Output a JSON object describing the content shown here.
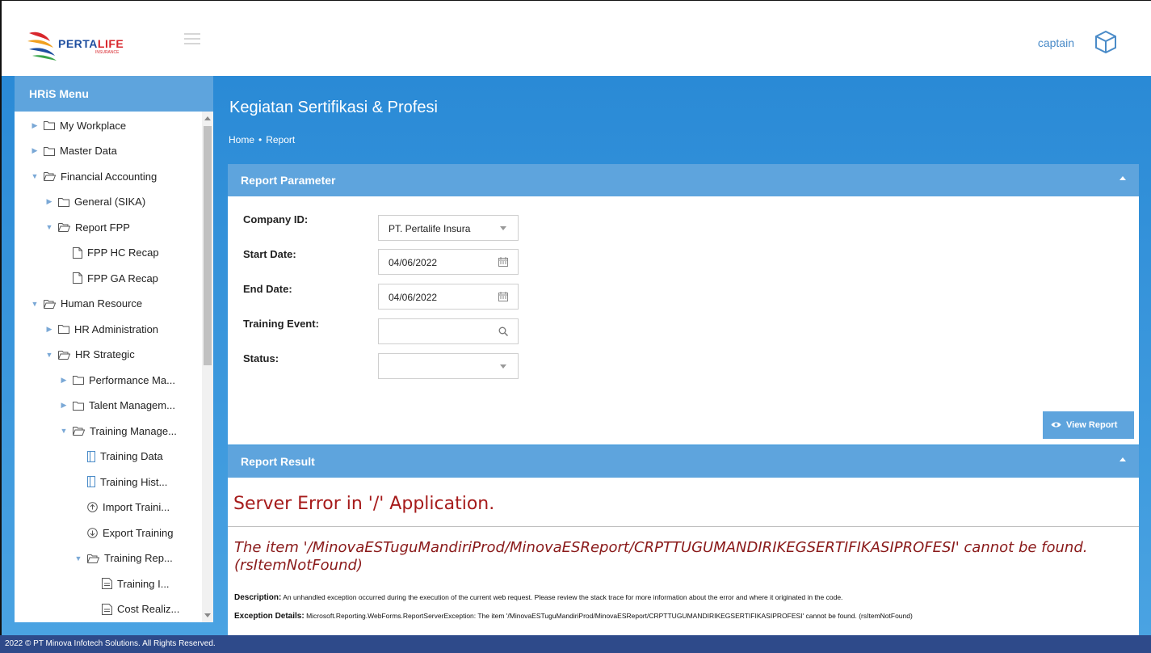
{
  "brand": {
    "logo_text_a": "PERTA",
    "logo_text_b": "LIFE",
    "logo_sub": "INSURANCE"
  },
  "header": {
    "user_name": "captain"
  },
  "sidebar": {
    "title": "HRiS Menu",
    "items": [
      {
        "label": "My Workplace",
        "arrow": "▶",
        "icon": "folder-icon"
      },
      {
        "label": "Master Data",
        "arrow": "▶",
        "icon": "folder-icon"
      },
      {
        "label": "Financial Accounting",
        "arrow": "▼",
        "icon": "folder-open-icon"
      },
      {
        "label": "General (SIKA)",
        "arrow": "▶",
        "icon": "folder-icon"
      },
      {
        "label": "Report FPP",
        "arrow": "▼",
        "icon": "folder-open-icon"
      },
      {
        "label": "FPP HC Recap",
        "arrow": "",
        "icon": "file-icon"
      },
      {
        "label": "FPP GA Recap",
        "arrow": "",
        "icon": "file-icon"
      },
      {
        "label": "Human Resource",
        "arrow": "▼",
        "icon": "folder-open-icon"
      },
      {
        "label": "HR Administration",
        "arrow": "▶",
        "icon": "folder-icon"
      },
      {
        "label": "HR Strategic",
        "arrow": "▼",
        "icon": "folder-open-icon"
      },
      {
        "label": "Performance Ma...",
        "arrow": "▶",
        "icon": "folder-icon"
      },
      {
        "label": "Talent Managem...",
        "arrow": "▶",
        "icon": "folder-icon"
      },
      {
        "label": "Training Manage...",
        "arrow": "▼",
        "icon": "folder-open-icon"
      },
      {
        "label": "Training Data",
        "arrow": "",
        "icon": "form-icon"
      },
      {
        "label": "Training Hist...",
        "arrow": "",
        "icon": "form-icon"
      },
      {
        "label": "Import Traini...",
        "arrow": "",
        "icon": "upload-icon"
      },
      {
        "label": "Export Training",
        "arrow": "",
        "icon": "download-icon"
      },
      {
        "label": "Training Rep...",
        "arrow": "▼",
        "icon": "folder-open-icon"
      },
      {
        "label": "Training I...",
        "arrow": "",
        "icon": "report-icon"
      },
      {
        "label": "Cost Realiz...",
        "arrow": "",
        "icon": "report-icon"
      }
    ]
  },
  "page": {
    "title": "Kegiatan Sertifikasi & Profesi",
    "breadcrumb": {
      "home": "Home",
      "sep": "•",
      "current": "Report"
    }
  },
  "report_parameter": {
    "header": "Report Parameter",
    "fields": {
      "company_label": "Company ID:",
      "company_value": "PT. Pertalife Insura",
      "start_label": "Start Date:",
      "start_value": "04/06/2022",
      "end_label": "End Date:",
      "end_value": "04/06/2022",
      "event_label": "Training Event:",
      "event_value": "",
      "status_label": "Status:",
      "status_value": ""
    },
    "view_button": "View Report"
  },
  "report_result": {
    "header": "Report Result",
    "error_title": "Server Error in '/' Application.",
    "error_message": "The item '/MinovaESTuguMandiriProd/MinovaESReport/CRPTTUGUMANDIRIKEGSERTIFIKASIPROFESI' cannot be found. (rsItemNotFound)",
    "description_label": "Description:",
    "description_text": "An unhandled exception occurred during the execution of the current web request. Please review the stack trace for more information about the error and where it originated in the code.",
    "exception_label": "Exception Details:",
    "exception_text": "Microsoft.Reporting.WebForms.ReportServerException: The item '/MinovaESTuguMandiriProd/MinovaESReport/CRPTTUGUMANDIRIKEGSERTIFIKASIPROFESI' cannot be found. (rsItemNotFound)"
  },
  "footer": {
    "text": "2022 © PT Minova Infotech Solutions. All Rights Reserved."
  },
  "colors": {
    "primary": "#2a8ad6",
    "panel": "#5ea4dd",
    "footer": "#2e4a8a",
    "error": "#a61b1b"
  }
}
